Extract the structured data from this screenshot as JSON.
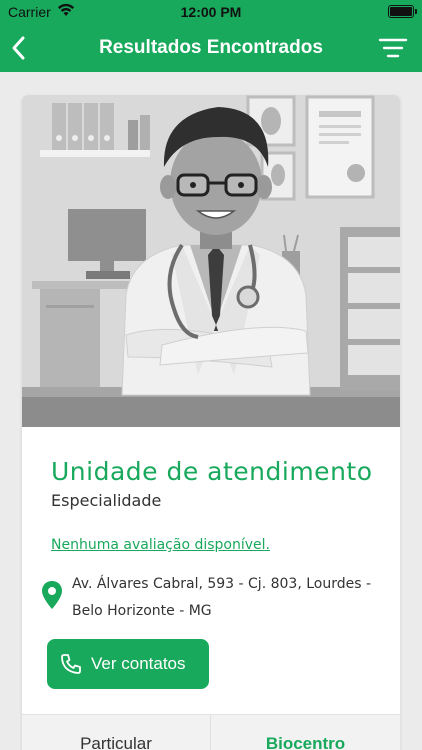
{
  "status_bar": {
    "carrier": "Carrier",
    "time": "12:00 PM",
    "battery_level": 1.0
  },
  "nav": {
    "title": "Resultados Encontrados",
    "back_icon": "chevron-left-icon",
    "filter_icon": "filter-lines-icon"
  },
  "card": {
    "image": "doctor-illustration",
    "unit_name": "Unidade de atendimento",
    "specialty": "Especialidade",
    "reviews_link": "Nenhuma avaliação disponível.",
    "address_icon": "map-pin-icon",
    "address_line1": "Av. Álvares Cabral, 593 - Cj. 803, Lourdes -",
    "address_line2": "Belo Horizonte - MG",
    "contacts_button": "Ver contatos",
    "contacts_icon": "phone-icon"
  },
  "tabs": [
    {
      "label": "Particular",
      "active": false
    },
    {
      "label": "Biocentro",
      "active": true
    }
  ],
  "colors": {
    "brand_green": "#19a95c",
    "background": "#ebebeb"
  }
}
